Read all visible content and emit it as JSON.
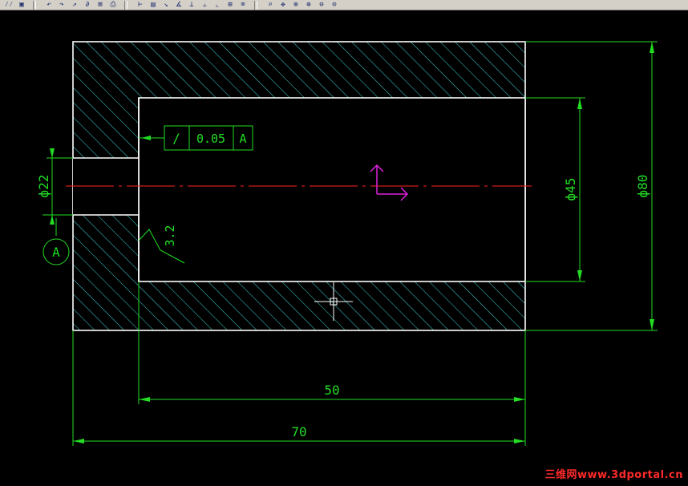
{
  "toolbar": {
    "groups": [
      [
        {
          "icon": "layer-icon",
          "glyph": "⁄⁄"
        },
        {
          "icon": "save-icon",
          "glyph": "▣"
        }
      ],
      [
        {
          "icon": "undo-icon",
          "glyph": "↶"
        },
        {
          "icon": "redo-icon",
          "glyph": "↷"
        },
        {
          "icon": "arrow-icon",
          "glyph": "↗"
        },
        {
          "icon": "snap-icon",
          "glyph": "∂"
        },
        {
          "icon": "grid-icon",
          "glyph": "⊠"
        },
        {
          "icon": "print-icon",
          "glyph": "⎙"
        }
      ],
      [
        {
          "icon": "dimension-icon",
          "glyph": "⊢"
        },
        {
          "icon": "table-icon",
          "glyph": "▤"
        },
        {
          "icon": "dim-align-icon",
          "glyph": "↘"
        },
        {
          "icon": "dim-angle-icon",
          "glyph": "∡"
        },
        {
          "icon": "dim-vertical-icon",
          "glyph": "⊥"
        },
        {
          "icon": "dim-base-icon",
          "glyph": "⫠"
        },
        {
          "icon": "leader-icon",
          "glyph": "⌞"
        },
        {
          "icon": "tolerance-icon",
          "glyph": "⊞"
        },
        {
          "icon": "edit-dim-icon",
          "glyph": "⌧"
        }
      ],
      [
        {
          "icon": "zoom-window-icon",
          "glyph": "⌕"
        },
        {
          "icon": "pan-icon",
          "glyph": "✥"
        },
        {
          "icon": "zoom-realtime-icon",
          "glyph": "⊕"
        },
        {
          "icon": "zoom-in-icon",
          "glyph": "⊕"
        },
        {
          "icon": "zoom-out-icon",
          "glyph": "⊖"
        },
        {
          "icon": "zoom-extents-icon",
          "glyph": "⊙"
        }
      ]
    ]
  },
  "drawing": {
    "colors": {
      "outline": "#ffffff",
      "hatch": "#3fd6d6",
      "dimension": "#22dd22",
      "centerline": "#ff2222",
      "ucs": "#dd22dd",
      "background": "#000000"
    },
    "dimensions": {
      "length_total": "70",
      "length_bore": "50",
      "diameter_outer": "ф80",
      "diameter_bore": "ф45",
      "diameter_hole": "ф22"
    },
    "tolerance_frame": {
      "symbol": "/",
      "value": "0.05",
      "datum": "A"
    },
    "surface_roughness": "3.2",
    "datum_label": "A"
  },
  "watermark": "三维网www.3dportal.cn"
}
